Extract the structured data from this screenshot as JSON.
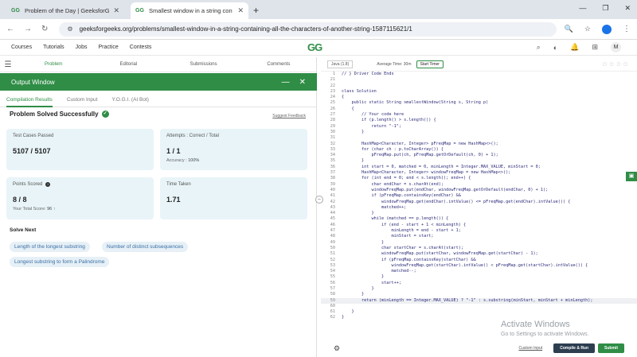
{
  "browser": {
    "tabs": [
      {
        "title": "Problem of the Day | GeeksforG",
        "favicon": "GG"
      },
      {
        "title": "Smallest window in a string con",
        "favicon": "GG"
      }
    ],
    "url": "geeksforgeeks.org/problems/smallest-window-in-a-string-containing-all-the-characters-of-another-string-1587115621/1"
  },
  "site": {
    "menu": [
      "Courses",
      "Tutorials",
      "Jobs",
      "Practice",
      "Contests"
    ],
    "logo": "GG",
    "avatar": "M"
  },
  "problem_tabs": [
    "Problem",
    "Editorial",
    "Submissions",
    "Comments"
  ],
  "output": {
    "title": "Output Window",
    "subtabs": [
      "Compilation Results",
      "Custom Input",
      "Y.O.G.I. (AI Bot)"
    ],
    "status": "Problem Solved Successfully",
    "feedback": "Suggest Feedback",
    "cards": {
      "test_label": "Test Cases Passed",
      "test_value": "5107 / 5107",
      "attempts_label": "Attempts : Correct / Total",
      "attempts_value": "1 / 1",
      "accuracy_label": "Accuracy :",
      "accuracy_value": "100%",
      "points_label": "Points Scored",
      "points_value": "8 / 8",
      "total_label": "Your Total Score:",
      "total_value": "96",
      "time_label": "Time Taken",
      "time_value": "1.71"
    },
    "solve_next": "Solve Next",
    "chips": [
      "Length of the longest substring",
      "Number of distinct subsequences",
      "Longest substring to form a Palindrome"
    ]
  },
  "editor": {
    "language": "Java (1.8)",
    "avg_time": "Average Time: 30m",
    "timer": "Start Timer",
    "custom_input": "Custom Input",
    "compile": "Compile & Run",
    "submit": "Submit",
    "lines": [
      {
        "n": "1",
        "t": "// } Driver Code Ends"
      },
      {
        "n": "21",
        "t": ""
      },
      {
        "n": "22",
        "t": ""
      },
      {
        "n": "23",
        "t": "class Solution"
      },
      {
        "n": "24",
        "t": "{"
      },
      {
        "n": "25",
        "t": "    public static String smallestWindow(String s, String p)"
      },
      {
        "n": "26",
        "t": "    {"
      },
      {
        "n": "27",
        "t": "        // Your code here"
      },
      {
        "n": "28",
        "t": "        if (p.length() > s.length()) {"
      },
      {
        "n": "29",
        "t": "            return \"-1\";"
      },
      {
        "n": "30",
        "t": "        }"
      },
      {
        "n": "31",
        "t": ""
      },
      {
        "n": "32",
        "t": "        HashMap<Character, Integer> pFreqMap = new HashMap<>();"
      },
      {
        "n": "33",
        "t": "        for (char ch : p.toCharArray()) {"
      },
      {
        "n": "34",
        "t": "            pFreqMap.put(ch, pFreqMap.getOrDefault(ch, 0) + 1);"
      },
      {
        "n": "35",
        "t": "        }"
      },
      {
        "n": "36",
        "t": "        int start = 0, matched = 0, minLength = Integer.MAX_VALUE, minStart = 0;"
      },
      {
        "n": "37",
        "t": "        HashMap<Character, Integer> windowFreqMap = new HashMap<>();"
      },
      {
        "n": "38",
        "t": "        for (int end = 0; end < s.length(); end++) {"
      },
      {
        "n": "39",
        "t": "            char endChar = s.charAt(end);"
      },
      {
        "n": "40",
        "t": "            windowFreqMap.put(endChar, windowFreqMap.getOrDefault(endChar, 0) + 1);"
      },
      {
        "n": "41",
        "t": "            if (pFreqMap.containsKey(endChar) &&"
      },
      {
        "n": "42",
        "t": "                windowFreqMap.get(endChar).intValue() <= pFreqMap.get(endChar).intValue()) {"
      },
      {
        "n": "43",
        "t": "                matched++;"
      },
      {
        "n": "44",
        "t": "            }"
      },
      {
        "n": "45",
        "t": "            while (matched == p.length()) {"
      },
      {
        "n": "46",
        "t": "                if (end - start + 1 < minLength) {"
      },
      {
        "n": "47",
        "t": "                    minLength = end - start + 1;"
      },
      {
        "n": "48",
        "t": "                    minStart = start;"
      },
      {
        "n": "49",
        "t": "                }"
      },
      {
        "n": "50",
        "t": "                char startChar = s.charAt(start);"
      },
      {
        "n": "51",
        "t": "                windowFreqMap.put(startChar, windowFreqMap.get(startChar) - 1);"
      },
      {
        "n": "52",
        "t": "                if (pFreqMap.containsKey(startChar) &&"
      },
      {
        "n": "53",
        "t": "                    windowFreqMap.get(startChar).intValue() < pFreqMap.get(startChar).intValue()) {"
      },
      {
        "n": "54",
        "t": "                    matched--;"
      },
      {
        "n": "55",
        "t": "                }"
      },
      {
        "n": "56",
        "t": "                start++;"
      },
      {
        "n": "57",
        "t": "            }"
      },
      {
        "n": "58",
        "t": "        }"
      },
      {
        "n": "59",
        "t": "        return (minLength == Integer.MAX_VALUE) ? \"-1\" : s.substring(minStart, minStart + minLength);"
      },
      {
        "n": "60",
        "t": ""
      },
      {
        "n": "61",
        "t": "    }"
      },
      {
        "n": "62",
        "t": "}"
      }
    ]
  },
  "watermark": {
    "title": "Activate Windows",
    "sub": "Go to Settings to activate Windows."
  },
  "colors": {
    "brand": "#2f8d46",
    "card": "#e8f4f8"
  }
}
